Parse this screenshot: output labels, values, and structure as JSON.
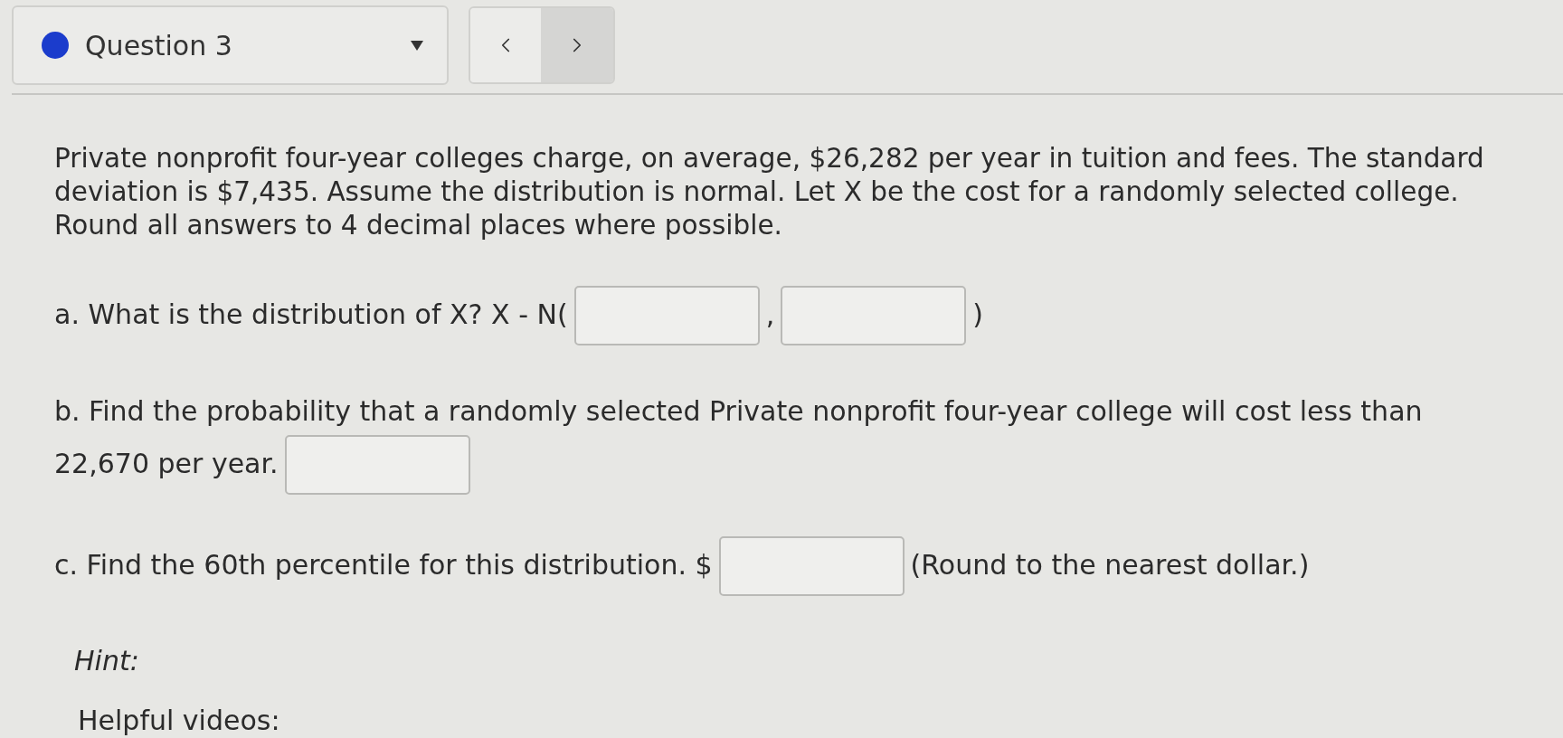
{
  "question_nav": {
    "title": "Question 3"
  },
  "question": {
    "prompt": "Private nonprofit four-year colleges charge, on average, $26,282 per year in tuition and fees. The standard deviation is $7,435. Assume the distribution is normal. Let X be the cost for a randomly selected college. Round all answers to 4 decimal places where possible.",
    "parts": [
      {
        "segments": [
          {
            "kind": "text",
            "text": "a. What is the distribution of X? X - N("
          },
          {
            "kind": "input"
          },
          {
            "kind": "text",
            "text": ","
          },
          {
            "kind": "input"
          },
          {
            "kind": "text",
            "text": ")"
          }
        ]
      },
      {
        "segments": [
          {
            "kind": "text",
            "text": "b. Find the probability that a randomly selected Private nonprofit four-year college will cost less than"
          },
          {
            "kind": "break"
          },
          {
            "kind": "text",
            "text": "22,670 per year."
          },
          {
            "kind": "input"
          }
        ]
      },
      {
        "segments": [
          {
            "kind": "text",
            "text": "c. Find the 60th percentile for this distribution. $"
          },
          {
            "kind": "input"
          },
          {
            "kind": "text",
            "text": "(Round to the nearest dollar.)"
          }
        ]
      }
    ]
  },
  "hint": {
    "label": "Hint:"
  },
  "helpful_videos": {
    "label": "Helpful videos:"
  }
}
